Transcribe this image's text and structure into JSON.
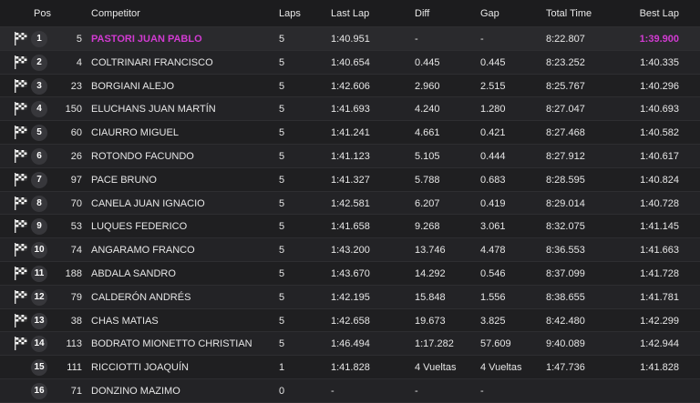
{
  "headers": {
    "pos": "Pos",
    "competitor": "Competitor",
    "laps": "Laps",
    "last_lap": "Last Lap",
    "diff": "Diff",
    "gap": "Gap",
    "total_time": "Total Time",
    "best_lap": "Best Lap"
  },
  "colors": {
    "leader_highlight": "#d23bd2",
    "background": "#1f1f21",
    "badge": "#37373b"
  },
  "rows": [
    {
      "pos": "1",
      "num": "5",
      "name": "PASTORI JUAN PABLO",
      "laps": "5",
      "last": "1:40.951",
      "diff": "-",
      "gap": "-",
      "total": "8:22.807",
      "best": "1:39.900",
      "flag": true
    },
    {
      "pos": "2",
      "num": "4",
      "name": "COLTRINARI FRANCISCO",
      "laps": "5",
      "last": "1:40.654",
      "diff": "0.445",
      "gap": "0.445",
      "total": "8:23.252",
      "best": "1:40.335",
      "flag": true
    },
    {
      "pos": "3",
      "num": "23",
      "name": "BORGIANI ALEJO",
      "laps": "5",
      "last": "1:42.606",
      "diff": "2.960",
      "gap": "2.515",
      "total": "8:25.767",
      "best": "1:40.296",
      "flag": true
    },
    {
      "pos": "4",
      "num": "150",
      "name": "ELUCHANS JUAN MARTÍN",
      "laps": "5",
      "last": "1:41.693",
      "diff": "4.240",
      "gap": "1.280",
      "total": "8:27.047",
      "best": "1:40.693",
      "flag": true
    },
    {
      "pos": "5",
      "num": "60",
      "name": "CIAURRO MIGUEL",
      "laps": "5",
      "last": "1:41.241",
      "diff": "4.661",
      "gap": "0.421",
      "total": "8:27.468",
      "best": "1:40.582",
      "flag": true
    },
    {
      "pos": "6",
      "num": "26",
      "name": "ROTONDO FACUNDO",
      "laps": "5",
      "last": "1:41.123",
      "diff": "5.105",
      "gap": "0.444",
      "total": "8:27.912",
      "best": "1:40.617",
      "flag": true
    },
    {
      "pos": "7",
      "num": "97",
      "name": "PACE BRUNO",
      "laps": "5",
      "last": "1:41.327",
      "diff": "5.788",
      "gap": "0.683",
      "total": "8:28.595",
      "best": "1:40.824",
      "flag": true
    },
    {
      "pos": "8",
      "num": "70",
      "name": "CANELA JUAN IGNACIO",
      "laps": "5",
      "last": "1:42.581",
      "diff": "6.207",
      "gap": "0.419",
      "total": "8:29.014",
      "best": "1:40.728",
      "flag": true
    },
    {
      "pos": "9",
      "num": "53",
      "name": "LUQUES FEDERICO",
      "laps": "5",
      "last": "1:41.658",
      "diff": "9.268",
      "gap": "3.061",
      "total": "8:32.075",
      "best": "1:41.145",
      "flag": true
    },
    {
      "pos": "10",
      "num": "74",
      "name": "ANGARAMO FRANCO",
      "laps": "5",
      "last": "1:43.200",
      "diff": "13.746",
      "gap": "4.478",
      "total": "8:36.553",
      "best": "1:41.663",
      "flag": true
    },
    {
      "pos": "11",
      "num": "188",
      "name": "ABDALA SANDRO",
      "laps": "5",
      "last": "1:43.670",
      "diff": "14.292",
      "gap": "0.546",
      "total": "8:37.099",
      "best": "1:41.728",
      "flag": true
    },
    {
      "pos": "12",
      "num": "79",
      "name": "CALDERÓN ANDRÉS",
      "laps": "5",
      "last": "1:42.195",
      "diff": "15.848",
      "gap": "1.556",
      "total": "8:38.655",
      "best": "1:41.781",
      "flag": true
    },
    {
      "pos": "13",
      "num": "38",
      "name": "CHAS MATIAS",
      "laps": "5",
      "last": "1:42.658",
      "diff": "19.673",
      "gap": "3.825",
      "total": "8:42.480",
      "best": "1:42.299",
      "flag": true
    },
    {
      "pos": "14",
      "num": "113",
      "name": "BODRATO MIONETTO CHRISTIAN",
      "laps": "5",
      "last": "1:46.494",
      "diff": "1:17.282",
      "gap": "57.609",
      "total": "9:40.089",
      "best": "1:42.944",
      "flag": true
    },
    {
      "pos": "15",
      "num": "111",
      "name": "RICCIOTTI JOAQUÍN",
      "laps": "1",
      "last": "1:41.828",
      "diff": "4 Vueltas",
      "gap": "4 Vueltas",
      "total": "1:47.736",
      "best": "1:41.828",
      "flag": false
    },
    {
      "pos": "16",
      "num": "71",
      "name": "DONZINO MAZIMO",
      "laps": "0",
      "last": "-",
      "diff": "-",
      "gap": "-",
      "total": "",
      "best": "",
      "flag": false
    }
  ]
}
